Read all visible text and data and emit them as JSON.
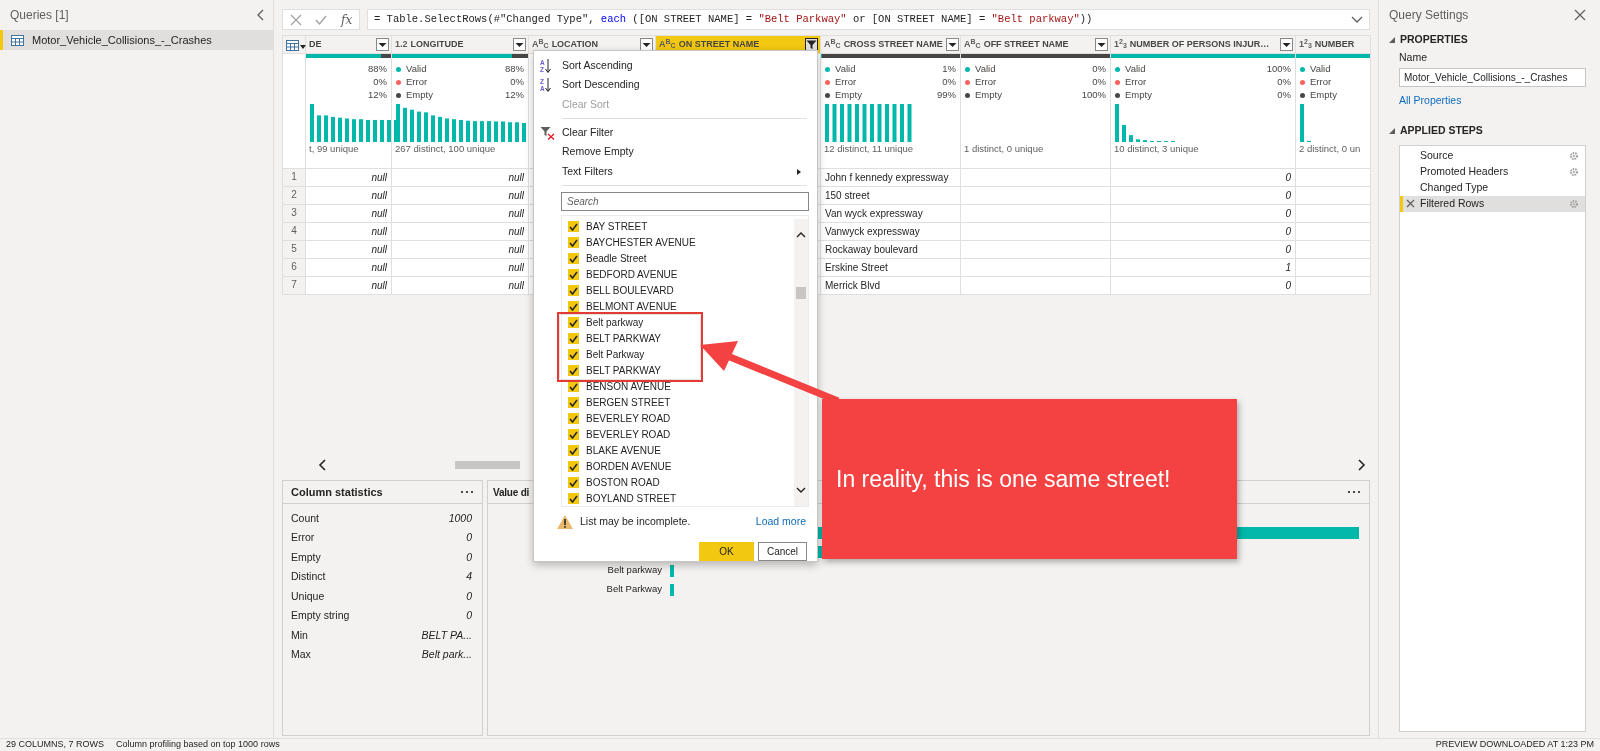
{
  "queries_panel": {
    "title": "Queries [1]",
    "items": [
      {
        "label": "Motor_Vehicle_Collisions_-_Crashes",
        "selected": true
      }
    ]
  },
  "formula_bar": {
    "function_label": "fx",
    "segments": [
      {
        "kind": "plain",
        "text": "= Table.SelectRows(#\"Changed Type\", "
      },
      {
        "kind": "keyword",
        "text": "each"
      },
      {
        "kind": "plain",
        "text": " ([ON STREET NAME] = "
      },
      {
        "kind": "string",
        "text": "\"Belt Parkway\""
      },
      {
        "kind": "plain",
        "text": " or [ON STREET NAME] = "
      },
      {
        "kind": "string",
        "text": "\"Belt parkway\""
      },
      {
        "kind": "plain",
        "text": "))"
      }
    ]
  },
  "row_numbers": [
    "1",
    "2",
    "3",
    "4",
    "5",
    "6",
    "7"
  ],
  "columns": [
    {
      "kind": "decimal",
      "name": "DE",
      "menu_button": true,
      "filtered": false,
      "selected": false,
      "profile": [
        {
          "value": "88%"
        },
        {
          "value": "0%"
        },
        {
          "value": "12%"
        }
      ],
      "histogram": {
        "kind": "flat"
      },
      "footer": "t, 99 unique",
      "cells": [
        "null",
        "null",
        "null",
        "null",
        "null",
        "null",
        "null"
      ]
    },
    {
      "kind": "decimal",
      "type_label": "1.2",
      "name": "LONGITUDE",
      "menu_button": true,
      "filtered": false,
      "selected": false,
      "profile": [
        {
          "label": "Valid",
          "value": "88%",
          "color": "#01b8aa"
        },
        {
          "label": "Error",
          "value": "0%",
          "color": "#fd625e"
        },
        {
          "label": "Empty",
          "value": "12%",
          "color": "#484644"
        }
      ],
      "histogram": {
        "kind": "decreasing"
      },
      "footer": "267 distinct, 100 unique",
      "cells": [
        "null",
        "null",
        "null",
        "null",
        "null",
        "null",
        "null"
      ]
    },
    {
      "kind": "text",
      "type_label": "A$^{B}$$_{C}$",
      "name": "LOCATION",
      "menu_button": true,
      "filtered": false,
      "selected": false
    },
    {
      "kind": "text",
      "type_label": "A$^{B}$$_{C}$",
      "name": "ON STREET NAME",
      "menu_button": true,
      "filtered": true,
      "selected": true
    },
    {
      "kind": "text",
      "type_label": "A$^{B}$$_{C}$",
      "name": "CROSS STREET NAME",
      "menu_button": true,
      "filtered": false,
      "selected": false,
      "profile": [
        {
          "label": "Valid",
          "value": "1%",
          "color": "#01b8aa"
        },
        {
          "label": "Error",
          "value": "0%",
          "color": "#fd625e"
        },
        {
          "label": "Empty",
          "value": "99%",
          "color": "#484644"
        }
      ],
      "histogram": {
        "kind": "comb"
      },
      "footer": "12 distinct, 11 unique",
      "cells": [
        "John f kennedy expressway",
        "150 street",
        "Van wyck expressway",
        "Vanwyck expressway",
        "Rockaway boulevard",
        "Erskine Street",
        "Merrick Blvd"
      ]
    },
    {
      "kind": "text",
      "type_label": "A$^{B}$$_{C}$",
      "name": "OFF STREET NAME",
      "menu_button": true,
      "filtered": false,
      "selected": false,
      "profile": [
        {
          "label": "Valid",
          "value": "0%",
          "color": "#01b8aa"
        },
        {
          "label": "Error",
          "value": "0%",
          "color": "#fd625e"
        },
        {
          "label": "Empty",
          "value": "100%",
          "color": "#484644"
        }
      ],
      "footer": "1 distinct, 0 unique"
    },
    {
      "kind": "whole",
      "type_label": "1$^{2}$$_{3}$",
      "name": "NUMBER OF PERSONS INJUR…",
      "menu_button": true,
      "filtered": false,
      "selected": false,
      "profile": [
        {
          "label": "Valid",
          "value": "100%",
          "color": "#01b8aa"
        },
        {
          "label": "Error",
          "value": "0%",
          "color": "#fd625e"
        },
        {
          "label": "Empty",
          "value": "0%",
          "color": "#484644"
        }
      ],
      "histogram": {
        "kind": "skewed"
      },
      "footer": "10 distinct, 3 unique",
      "cells": [
        "0",
        "0",
        "0",
        "0",
        "0",
        "1",
        "0"
      ]
    },
    {
      "kind": "whole",
      "type_label": "1$^{2}$$_{3}$",
      "name": "NUMBER",
      "menu_button": false,
      "selected": false,
      "profile": [
        {
          "label": "Valid",
          "color": "#01b8aa"
        },
        {
          "label": "Error",
          "color": "#fd625e"
        },
        {
          "label": "Empty",
          "color": "#484644"
        }
      ],
      "histogram": {
        "kind": "single"
      },
      "footer": "2 distinct, 0 un"
    }
  ],
  "column_statistics": {
    "title": "Column statistics",
    "rows": [
      {
        "label": "Count",
        "value": "1000"
      },
      {
        "label": "Error",
        "value": "0"
      },
      {
        "label": "Empty",
        "value": "0"
      },
      {
        "label": "Distinct",
        "value": "4"
      },
      {
        "label": "Unique",
        "value": "0"
      },
      {
        "label": "Empty string",
        "value": "0"
      },
      {
        "label": "Min",
        "value": "BELT PA..."
      },
      {
        "label": "Max",
        "value": "Belt park..."
      }
    ]
  },
  "value_distribution": {
    "title": "Value di",
    "labels": [
      "Belt parkway",
      "Belt Parkway"
    ]
  },
  "filter_menu": {
    "groups": [
      [
        {
          "label": "Sort Ascending",
          "icon": {
            "kind": "sort",
            "top": "A",
            "bottom": "Z"
          },
          "disabled": false
        },
        {
          "label": "Sort Descending",
          "icon": {
            "kind": "sort",
            "top": "Z",
            "bottom": "A"
          },
          "disabled": false
        },
        {
          "label": "Clear Sort",
          "disabled": true
        }
      ],
      [
        {
          "label": "Clear Filter",
          "icon": {
            "kind": "clear-filter"
          },
          "disabled": false
        },
        {
          "label": "Remove Empty",
          "disabled": false
        },
        {
          "label": "Text Filters",
          "submenu": true,
          "disabled": false
        }
      ]
    ],
    "search": {
      "placeholder": "Search"
    },
    "values": [
      {
        "label": "BAY STREET",
        "checked": true,
        "highlighted": false
      },
      {
        "label": "BAYCHESTER AVENUE",
        "checked": true,
        "highlighted": false
      },
      {
        "label": "Beadle Street",
        "checked": true,
        "highlighted": false
      },
      {
        "label": "BEDFORD AVENUE",
        "checked": true,
        "highlighted": false
      },
      {
        "label": "BELL BOULEVARD",
        "checked": true,
        "highlighted": false
      },
      {
        "label": "BELMONT AVENUE",
        "checked": true,
        "highlighted": false
      },
      {
        "label": "Belt parkway",
        "checked": true,
        "highlighted": true
      },
      {
        "label": "BELT PARKWAY",
        "checked": true,
        "highlighted": true
      },
      {
        "label": "Belt Parkway",
        "checked": true,
        "highlighted": true
      },
      {
        "label": "BELT PARKWAY",
        "checked": true,
        "highlighted": true
      },
      {
        "label": "BENSON AVENUE",
        "checked": true,
        "highlighted": false
      },
      {
        "label": "BERGEN STREET",
        "checked": true,
        "highlighted": false
      },
      {
        "label": "BEVERLEY ROAD",
        "checked": true,
        "highlighted": false
      },
      {
        "label": "BEVERLEY ROAD",
        "checked": true,
        "highlighted": false
      },
      {
        "label": "BLAKE AVENUE",
        "checked": true,
        "highlighted": false
      },
      {
        "label": "BORDEN AVENUE",
        "checked": true,
        "highlighted": false
      },
      {
        "label": "BOSTON ROAD",
        "checked": true,
        "highlighted": false
      },
      {
        "label": "BOYLAND STREET",
        "checked": true,
        "highlighted": false
      }
    ],
    "warning": "List may be incomplete.",
    "link": "Load more",
    "buttons": [
      {
        "label": "OK",
        "primary": true
      },
      {
        "label": "Cancel",
        "primary": false
      }
    ]
  },
  "callout": {
    "text": "In reality, this is one same street!"
  },
  "query_settings": {
    "title": "Query Settings",
    "properties": {
      "heading": "PROPERTIES",
      "expanded": true,
      "name_label": "Name",
      "name_value": "Motor_Vehicle_Collisions_-_Crashes",
      "link": "All Properties"
    },
    "applied_steps": {
      "heading": "APPLIED STEPS",
      "expanded": true,
      "steps": [
        {
          "label": "Source",
          "has_settings": true,
          "selected": false
        },
        {
          "label": "Promoted Headers",
          "has_settings": true,
          "selected": false
        },
        {
          "label": "Changed Type",
          "has_settings": false,
          "selected": false
        },
        {
          "label": "Filtered Rows",
          "has_settings": true,
          "selected": true
        }
      ]
    }
  },
  "status_bar": {
    "left": [
      "29 COLUMNS, 7 ROWS",
      "Column profiling based on top 1000 rows"
    ],
    "right": "PREVIEW DOWNLOADED AT 1:23 PM"
  }
}
